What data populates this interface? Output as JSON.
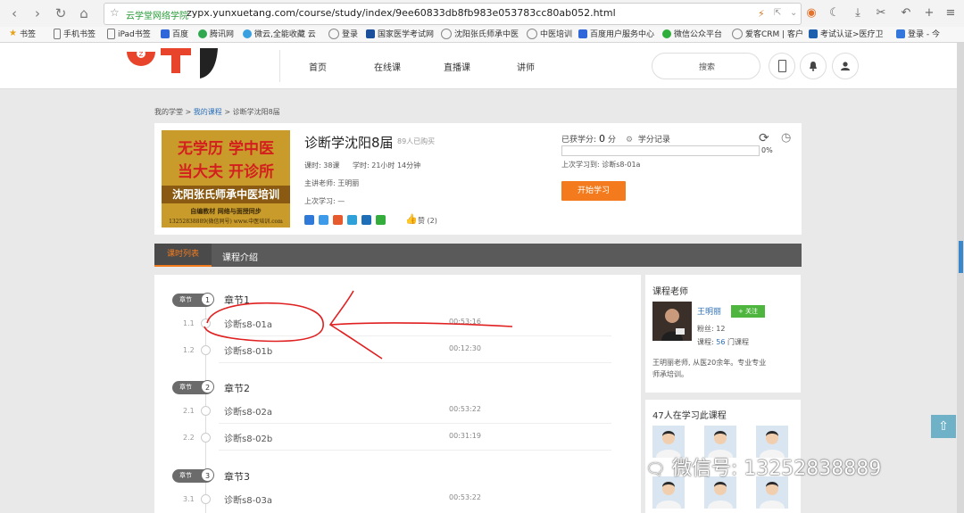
{
  "browser": {
    "site_name": "云学堂网络学院",
    "url": "zypx.yunxuetang.com/course/study/index/9ee60833db8fb983e053783cc80ab052.html",
    "bookmarks": [
      "书签",
      "手机书签",
      "iPad书签",
      "百度",
      "腾讯网",
      "微云,全能收藏 云",
      "登录",
      "国家医学考试网",
      "沈阳张氏师承中医",
      "中医培训",
      "百度用户服务中心",
      "微信公众平台",
      "爱客CRM | 客户",
      "考试认证>医疗卫",
      "登录 - 今"
    ]
  },
  "header": {
    "nav": [
      "首页",
      "在线课",
      "直播课",
      "讲师"
    ],
    "search_placeholder": "搜索"
  },
  "breadcrumb": {
    "home": "我的学堂",
    "sep1": " > ",
    "courses": "我的课程",
    "sep2": " > ",
    "current": "诊断学沈阳8届"
  },
  "course": {
    "title": "诊断学沈阳8届",
    "buyers": "89人已购买",
    "lessons": "课时: 38课",
    "hours": "学时: 21小时 14分钟",
    "teacher": "主讲老师:    王明丽",
    "last_study": "上次学习: —",
    "like": "赞 (2)",
    "cover_lines": [
      "无学历 学中医",
      "当大夫 开诊所",
      "沈阳张氏师承中医培训",
      "自编教材   网络与面授同步",
      "13252838889(微信同号) www.中医培训.com"
    ],
    "credit_label": "已获学分:",
    "credit_value": "0",
    "credit_unit": "分",
    "credit_record": "学分记录",
    "progress": "0%",
    "progress_value": 0,
    "last_lesson": "上次学习到: 诊断s8-01a",
    "start_label": "开始学习"
  },
  "tabs": [
    "课时列表",
    "课程介绍"
  ],
  "chapters": [
    {
      "badge": "章节",
      "num": "1",
      "title": "章节1",
      "lessons": [
        {
          "no": "1.1",
          "name": "诊断s8-01a",
          "time": "00:53:16"
        },
        {
          "no": "1.2",
          "name": "诊断s8-01b",
          "time": "00:12:30"
        }
      ]
    },
    {
      "badge": "章节",
      "num": "2",
      "title": "章节2",
      "lessons": [
        {
          "no": "2.1",
          "name": "诊断s8-02a",
          "time": "00:53:22"
        },
        {
          "no": "2.2",
          "name": "诊断s8-02b",
          "time": "00:31:19"
        }
      ]
    },
    {
      "badge": "章节",
      "num": "3",
      "title": "章节3",
      "lessons": [
        {
          "no": "3.1",
          "name": "诊断s8-03a",
          "time": "00:53:22"
        }
      ]
    }
  ],
  "teacher_panel": {
    "title": "课程老师",
    "name": "王明丽",
    "follow": "+ 关注",
    "fans": "粉丝: 12",
    "courses_label": "课程:",
    "courses_count": "56",
    "courses_unit": "门课程",
    "bio": "王明丽老师, 从医20余年。专业专业师承培训。"
  },
  "learners_panel": {
    "title": "47人在学习此课程"
  },
  "watermark": "微信号: 13252838889",
  "colors": {
    "accent": "#f37b1d",
    "link": "#2c6fb7",
    "follow": "#4eb53e",
    "annotation": "#e02020"
  }
}
